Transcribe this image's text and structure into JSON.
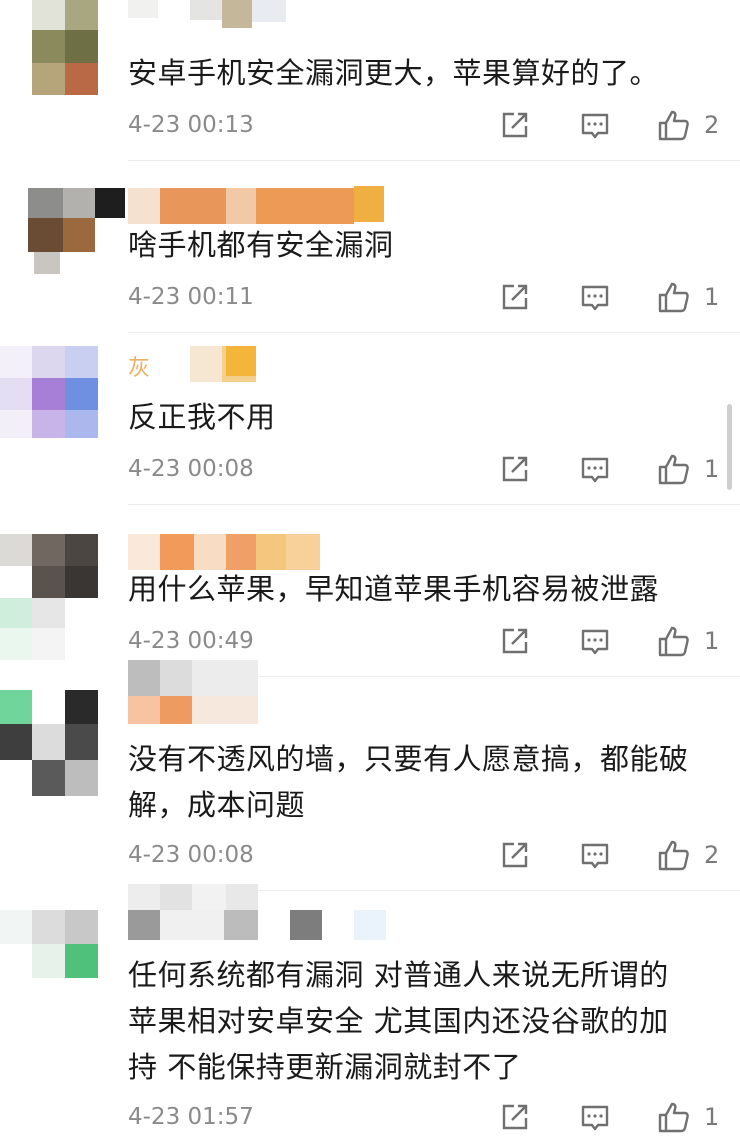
{
  "comments": [
    {
      "username": "",
      "text": "安卓手机安全漏洞更大，苹果算好的了。",
      "time": "4-23 00:13",
      "likes": "2"
    },
    {
      "username": "",
      "text": "啥手机都有安全漏洞",
      "time": "4-23 00:11",
      "likes": "1"
    },
    {
      "username": "灰",
      "text": "反正我不用",
      "time": "4-23 00:08",
      "likes": "1"
    },
    {
      "username": "",
      "text": "用什么苹果，早知道苹果手机容易被泄露",
      "time": "4-23 00:49",
      "likes": "1"
    },
    {
      "username": "",
      "text": "没有不透风的墙，只要有人愿意搞，都能破\n解，成本问题",
      "time": "4-23 00:08",
      "likes": "2"
    },
    {
      "username": "",
      "text": "任何系统都有漏洞 对普通人来说无所谓的\n苹果相对安卓安全 尤其国内还没谷歌的加\n持 不能保持更新漏洞就封不了",
      "time": "4-23 01:57",
      "likes": "1"
    }
  ],
  "icons": {
    "share": "share-icon",
    "reply": "comment-icon",
    "like": "thumbs-up-icon"
  },
  "colors": {
    "text": "#1a1a1a",
    "meta": "#8a8a8a",
    "icon": "#707070",
    "divider": "#ececec"
  }
}
